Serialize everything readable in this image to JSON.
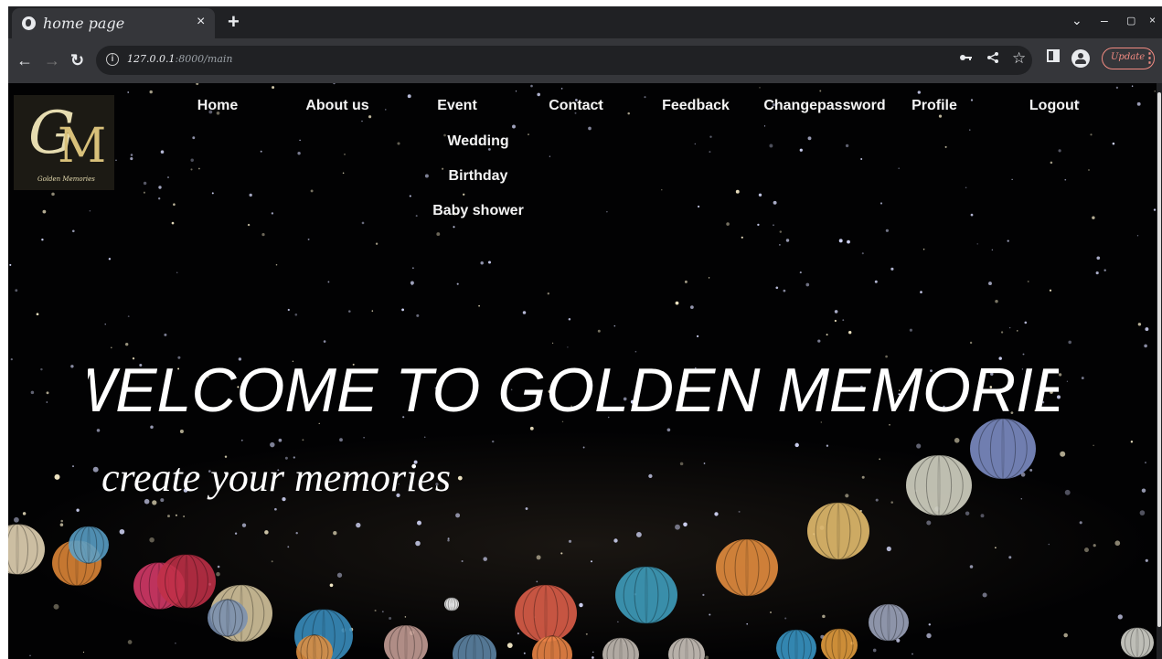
{
  "browser": {
    "tab_title": "home page",
    "tab_close": "×",
    "new_tab": "+",
    "url_host": "127.0.0.1",
    "url_path": ":8000/main",
    "update_label": "Update"
  },
  "site": {
    "logo_text": "Golden Memories",
    "nav": [
      {
        "label": "Home"
      },
      {
        "label": "About us"
      },
      {
        "label": "Event"
      },
      {
        "label": "Contact"
      },
      {
        "label": "Feedback"
      },
      {
        "label": "Changepassword"
      },
      {
        "label": "Profile"
      },
      {
        "label": "Logout"
      }
    ],
    "event_dropdown": [
      "Wedding",
      "Birthday",
      "Baby shower"
    ],
    "hero_title": "WELCOME TO GOLDEN MEMORIES",
    "hero_subtitle": "create your memories"
  },
  "colors": {
    "browser_chrome": "#202124",
    "toolbar": "#35363a",
    "update_accent": "#f28b82",
    "page_background": "#020203",
    "logo_gold": "#d8c07a"
  },
  "icons": [
    "globe-icon",
    "close-icon",
    "plus-icon",
    "back-arrow-icon",
    "forward-arrow-icon",
    "reload-icon",
    "info-icon",
    "key-icon",
    "share-icon",
    "star-icon",
    "side-panel-icon",
    "profile-icon",
    "kebab-menu-icon"
  ]
}
